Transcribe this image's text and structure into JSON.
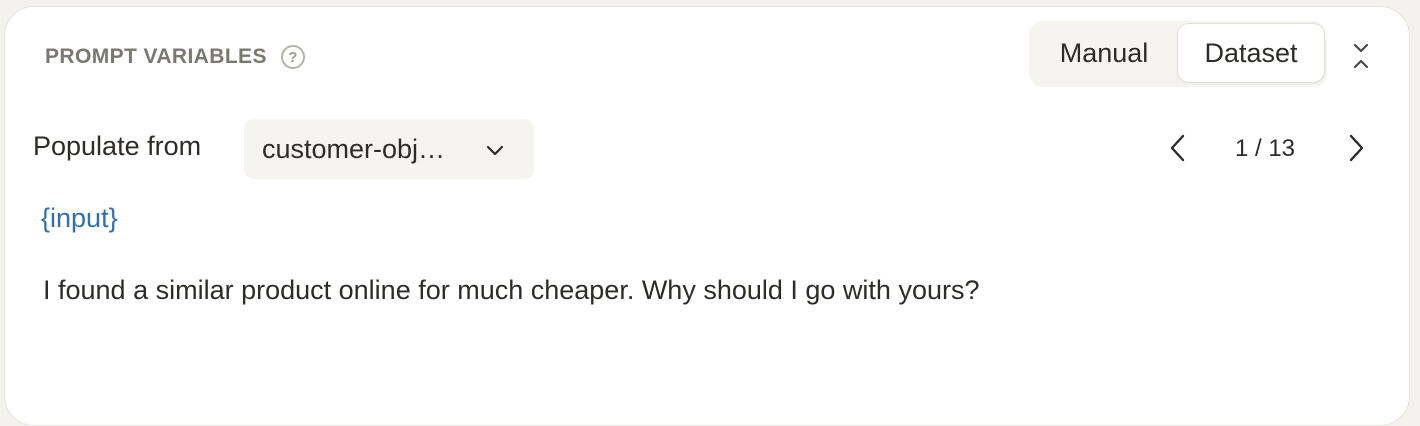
{
  "header": {
    "title": "PROMPT VARIABLES",
    "help_icon": "question-circle-icon"
  },
  "mode_toggle": {
    "options": [
      "Manual",
      "Dataset"
    ],
    "selected": "Dataset"
  },
  "collapse_icon": "collapse-chevrons-icon",
  "populate": {
    "label": "Populate from",
    "selected_dataset": "customer-obj…",
    "dropdown_icon": "chevron-down-icon"
  },
  "pager": {
    "text": "1 / 13",
    "current": 1,
    "total": 13
  },
  "variable": {
    "name": "{input}",
    "value": "I found a similar product online for much cheaper. Why should I go with yours?"
  },
  "colors": {
    "variable_name": "#2f6fb8",
    "header_label": "#7a7871",
    "toggle_bg": "#f5f4f0"
  }
}
